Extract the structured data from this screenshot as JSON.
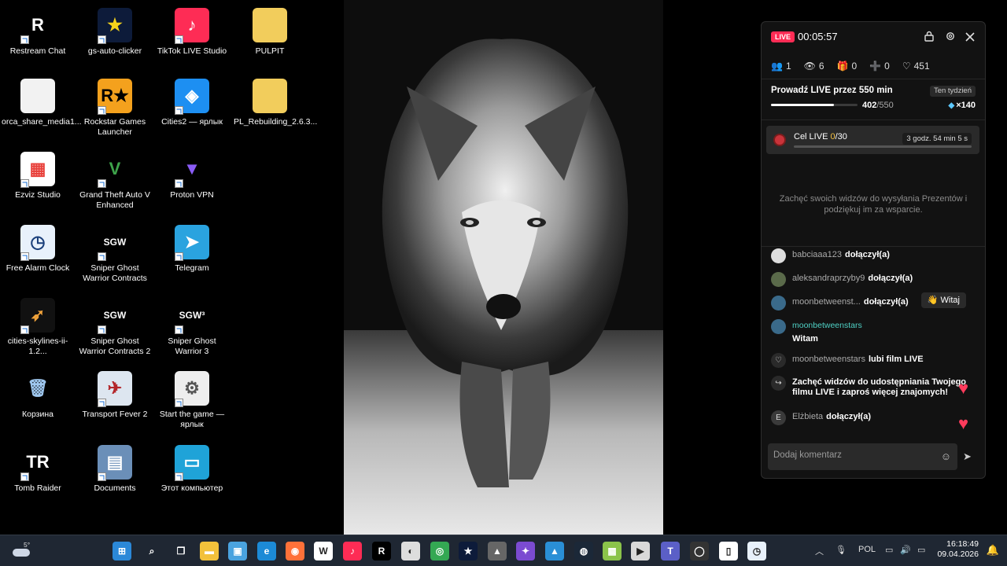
{
  "desktop": {
    "icons": [
      {
        "label": "Restream Chat",
        "glyph": "R",
        "color": "#000000",
        "fg": "#ffffff"
      },
      {
        "label": "orca_share_media1...",
        "glyph": "",
        "color": "#f2f2f2",
        "fg": "#000000"
      },
      {
        "label": "Ezviz Studio",
        "glyph": "▦",
        "color": "#ffffff",
        "fg": "#e8403a"
      },
      {
        "label": "Free Alarm Clock",
        "glyph": "◷",
        "color": "#e8f1fb",
        "fg": "#1a3f7a"
      },
      {
        "label": "cities-skylines-ii-1.2...",
        "glyph": "➶",
        "color": "#111111",
        "fg": "#f0a23a"
      },
      {
        "label": "Корзина",
        "glyph": "🗑",
        "color": "#000000",
        "fg": "#9fc8f0"
      },
      {
        "label": "Tomb Raider",
        "glyph": "TR",
        "color": "#000000",
        "fg": "#ffffff"
      },
      {
        "label": "gs-auto-clicker",
        "glyph": "★",
        "color": "#0d1b3a",
        "fg": "#f4d21b"
      },
      {
        "label": "Rockstar Games Launcher",
        "glyph": "R★",
        "color": "#f4a11d",
        "fg": "#000000"
      },
      {
        "label": "Grand Theft Auto V Enhanced",
        "glyph": "V",
        "color": "#000000",
        "fg": "#3ea34a"
      },
      {
        "label": "Sniper Ghost Warrior Contracts",
        "glyph": "SGW",
        "color": "#000000",
        "fg": "#ffffff"
      },
      {
        "label": "Sniper Ghost Warrior Contracts 2",
        "glyph": "SGW",
        "color": "#000000",
        "fg": "#ffffff"
      },
      {
        "label": "Transport Fever 2",
        "glyph": "✈",
        "color": "#dde6f0",
        "fg": "#b3262a"
      },
      {
        "label": "Documents",
        "glyph": "▤",
        "color": "#6b8fb8",
        "fg": "#ffffff"
      },
      {
        "label": "TikTok LIVE Studio",
        "glyph": "♪",
        "color": "#fe2c55",
        "fg": "#ffffff"
      },
      {
        "label": "Cities2 — ярлык",
        "glyph": "◈",
        "color": "#1d8ff2",
        "fg": "#ffffff"
      },
      {
        "label": "Proton VPN",
        "glyph": "▼",
        "color": "#000000",
        "fg": "#8a5cf6"
      },
      {
        "label": "Telegram",
        "glyph": "➤",
        "color": "#2aa3df",
        "fg": "#ffffff"
      },
      {
        "label": "Sniper Ghost Warrior 3",
        "glyph": "SGW³",
        "color": "#000000",
        "fg": "#ffffff"
      },
      {
        "label": "Start the game — ярлык",
        "glyph": "⚙",
        "color": "#eeeeee",
        "fg": "#555555"
      },
      {
        "label": "Этот компьютер",
        "glyph": "▭",
        "color": "#1fa3d8",
        "fg": "#ffffff"
      },
      {
        "label": "PULPIT",
        "glyph": "",
        "color": "#f2cd5c",
        "fg": "#ffffff"
      },
      {
        "label": "PL_Rebuilding_2.6.3...",
        "glyph": "",
        "color": "#f2cd5c",
        "fg": "#c03030"
      }
    ]
  },
  "live_panel": {
    "badge": "LIVE",
    "timer": "00:05:57",
    "stats": [
      {
        "icon": "👥",
        "value": "1"
      },
      {
        "icon": "👁",
        "value": "6"
      },
      {
        "icon": "🎁",
        "value": "0"
      },
      {
        "icon": "➕",
        "value": "0"
      },
      {
        "icon": "♡",
        "value": "451"
      }
    ],
    "goal_title": "Prowadź LIVE przez 550 min",
    "goal_period": "Ten tydzień",
    "goal_progress": 402,
    "goal_max": "/550",
    "goal_progress_fraction": 0.73,
    "goal_reward": "×140",
    "cel_label": "Cel LIVE",
    "cel_count": "0",
    "cel_max": "/30",
    "cel_time": "3 godz. 54 min 5 s",
    "encourage_text": "Zachęć swoich widzów do wysyłania Prezentów i podziękuj im za wsparcie.",
    "feed": [
      {
        "user": "babciaaa123",
        "action": "dołączył(a)",
        "avatar": "#dddddd"
      },
      {
        "user": "aleksandraprzyby9",
        "action": "dołączył(a)",
        "avatar": "#5a6a4a"
      },
      {
        "user": "moonbetweenst...",
        "action": "dołączył(a)",
        "avatar": "#3a6a8a",
        "button": "👋 Witaj"
      },
      {
        "user": "moonbetweenstars",
        "action": "",
        "message": "Witam",
        "avatar": "#3a6a8a"
      },
      {
        "user": "moonbetweenstars",
        "action": "lubi film LIVE",
        "avatar": "#2a2a2a",
        "icon": "♡"
      },
      {
        "user": "",
        "action": "Zachęć widzów do udostępniania Twojego filmu LIVE i zaproś więcej znajomych!",
        "avatar": "#2a2a2a",
        "icon": "↪"
      },
      {
        "user": "Elżbieta",
        "action": "dołączył(a)",
        "avatar": "#3a3a3a",
        "letter": "E"
      }
    ],
    "comment_placeholder": "Dodaj komentarz"
  },
  "taskbar": {
    "weather_temp": "5°",
    "language": "POL",
    "time": "16:18:49",
    "date": "09.04.2026",
    "apps": [
      {
        "name": "start-button",
        "glyph": "⊞",
        "color": "#2b88d8"
      },
      {
        "name": "search",
        "glyph": "⌕",
        "color": ""
      },
      {
        "name": "task-view",
        "glyph": "❐",
        "color": ""
      },
      {
        "name": "file-explorer",
        "glyph": "▬",
        "color": "#f2c13b"
      },
      {
        "name": "control-panel",
        "glyph": "▣",
        "color": "#4aa3df"
      },
      {
        "name": "edge",
        "glyph": "e",
        "color": "#1c8ad6"
      },
      {
        "name": "firefox",
        "glyph": "◉",
        "color": "#ff7139"
      },
      {
        "name": "wd-app",
        "glyph": "W",
        "color": "#ffffff"
      },
      {
        "name": "tiktok-live",
        "glyph": "♪",
        "color": "#fe2c55"
      },
      {
        "name": "restream",
        "glyph": "R",
        "color": "#000000"
      },
      {
        "name": "nv-app",
        "glyph": "◐",
        "color": "#dddddd"
      },
      {
        "name": "chrome",
        "glyph": "◎",
        "color": "#34a853"
      },
      {
        "name": "gs-auto-clicker",
        "glyph": "★",
        "color": "#0d1b3a"
      },
      {
        "name": "hat-app",
        "glyph": "▲",
        "color": "#666666"
      },
      {
        "name": "media-app",
        "glyph": "✦",
        "color": "#7b4bd1"
      },
      {
        "name": "photos",
        "glyph": "▲",
        "color": "#2a8fd6"
      },
      {
        "name": "steam",
        "glyph": "◍",
        "color": "#1b2838"
      },
      {
        "name": "map-app",
        "glyph": "▦",
        "color": "#8bc34a"
      },
      {
        "name": "media-player",
        "glyph": "▶",
        "color": "#d9d9d9"
      },
      {
        "name": "teams",
        "glyph": "T",
        "color": "#5b5fc7"
      },
      {
        "name": "obs",
        "glyph": "◯",
        "color": "#333333"
      },
      {
        "name": "notepad",
        "glyph": "▯",
        "color": "#ffffff"
      },
      {
        "name": "alarm-clock",
        "glyph": "◷",
        "color": "#e8f1fb"
      }
    ]
  }
}
